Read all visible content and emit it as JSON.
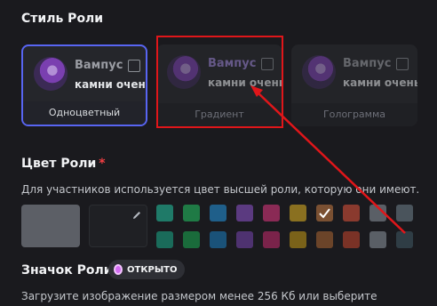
{
  "role_style": {
    "title": "Стиль Роли",
    "cards": [
      {
        "name": "Вампус",
        "message": "камни очень",
        "label": "Одноцветный",
        "name_color": "#9a9ca3",
        "selected": true
      },
      {
        "name": "Вампус",
        "message": "камни очень",
        "label": "Градиент",
        "name_color": "#9b83d6",
        "selected": false
      },
      {
        "name": "Вампус",
        "message": "камни очень",
        "label": "Голограмма",
        "name_color": "#9a9ca3",
        "selected": false
      }
    ]
  },
  "role_color": {
    "title": "Цвет Роли",
    "required_mark": "*",
    "description": "Для участников используется цвет высшей роли, которую они имеют.",
    "default_color": "#5c5f66",
    "custom_color": "#1f2024",
    "palette_row1": [
      "#1f7a68",
      "#1f7a45",
      "#1f5f8a",
      "#5b3a80",
      "#8a2a55",
      "#8a7020",
      "#7a5032",
      "#8a3a2e",
      "#5a5f66",
      "#4a545c"
    ],
    "palette_row2": [
      "#1a6b5a",
      "#1a6b3b",
      "#1a5279",
      "#4e3270",
      "#7a234a",
      "#7a6219",
      "#6b4429",
      "#7a3226",
      "#5a5f66",
      "#2f3d45"
    ],
    "selected_index": 6
  },
  "role_icon": {
    "title": "Значок Роли",
    "badge_label": "ОТКРЫТО",
    "description": "Загрузите изображение размером менее 256 Кб или выберите"
  },
  "annotation_color": "#e0161a"
}
